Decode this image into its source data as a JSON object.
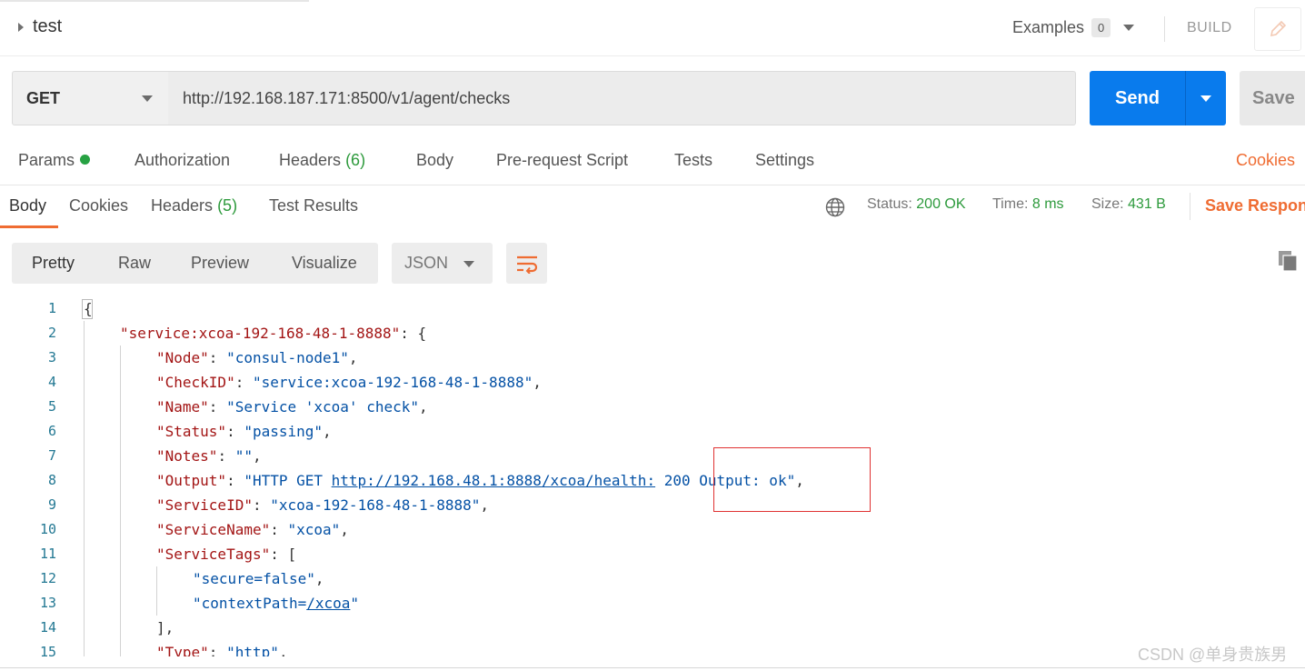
{
  "request": {
    "name": "test",
    "examples_label": "Examples",
    "examples_count": "0",
    "build_label": "BUILD",
    "method": "GET",
    "url": "http://192.168.187.171:8500/v1/agent/checks",
    "send_label": "Send",
    "save_label": "Save"
  },
  "request_tabs": {
    "params": "Params",
    "authorization": "Authorization",
    "headers": "Headers",
    "headers_count": "(6)",
    "body": "Body",
    "prerequest": "Pre-request Script",
    "tests": "Tests",
    "settings": "Settings",
    "cookies": "Cookies"
  },
  "response_tabs": {
    "body": "Body",
    "cookies": "Cookies",
    "headers": "Headers",
    "headers_count": "(5)",
    "test_results": "Test Results"
  },
  "status": {
    "status_label": "Status:",
    "status_value": "200 OK",
    "time_label": "Time:",
    "time_value": "8 ms",
    "size_label": "Size:",
    "size_value": "431 B",
    "save_response": "Save Respons"
  },
  "view": {
    "pretty": "Pretty",
    "raw": "Raw",
    "preview": "Preview",
    "visualize": "Visualize",
    "format": "JSON"
  },
  "code": {
    "line1": "{",
    "l2_key": "\"service:xcoa-192-168-48-1-8888\"",
    "l2_rest": ": {",
    "l3_key": "\"Node\"",
    "l3_val": "\"consul-node1\"",
    "l4_key": "\"CheckID\"",
    "l4_val": "\"service:xcoa-192-168-48-1-8888\"",
    "l5_key": "\"Name\"",
    "l5_val": "\"Service 'xcoa' check\"",
    "l6_key": "\"Status\"",
    "l6_val": "\"passing\"",
    "l7_key": "\"Notes\"",
    "l7_val": "\"\"",
    "l8_key": "\"Output\"",
    "l8_pre": "\"HTTP GET ",
    "l8_link": "http://192.168.48.1:8888/xcoa/health:",
    "l8_post": " 200 Output: ok\"",
    "l9_key": "\"ServiceID\"",
    "l9_val": "\"xcoa-192-168-48-1-8888\"",
    "l10_key": "\"ServiceName\"",
    "l10_val": "\"xcoa\"",
    "l11_key": "\"ServiceTags\"",
    "l11_rest": ": [",
    "l12_val": "\"secure=false\"",
    "l13_pre": "\"contextPath=",
    "l13_link": "/xcoa",
    "l13_post": "\"",
    "l14": "],",
    "l15_key": "\"Type\"",
    "l15_val": "\"http\""
  },
  "watermark": "CSDN @单身贵族男",
  "colors": {
    "send_blue": "#097bed",
    "accent_orange": "#ef6c32",
    "status_green": "#2d9a3c",
    "json_key": "#a31515",
    "json_string": "#0451a5",
    "highlight_red": "#e03131"
  }
}
